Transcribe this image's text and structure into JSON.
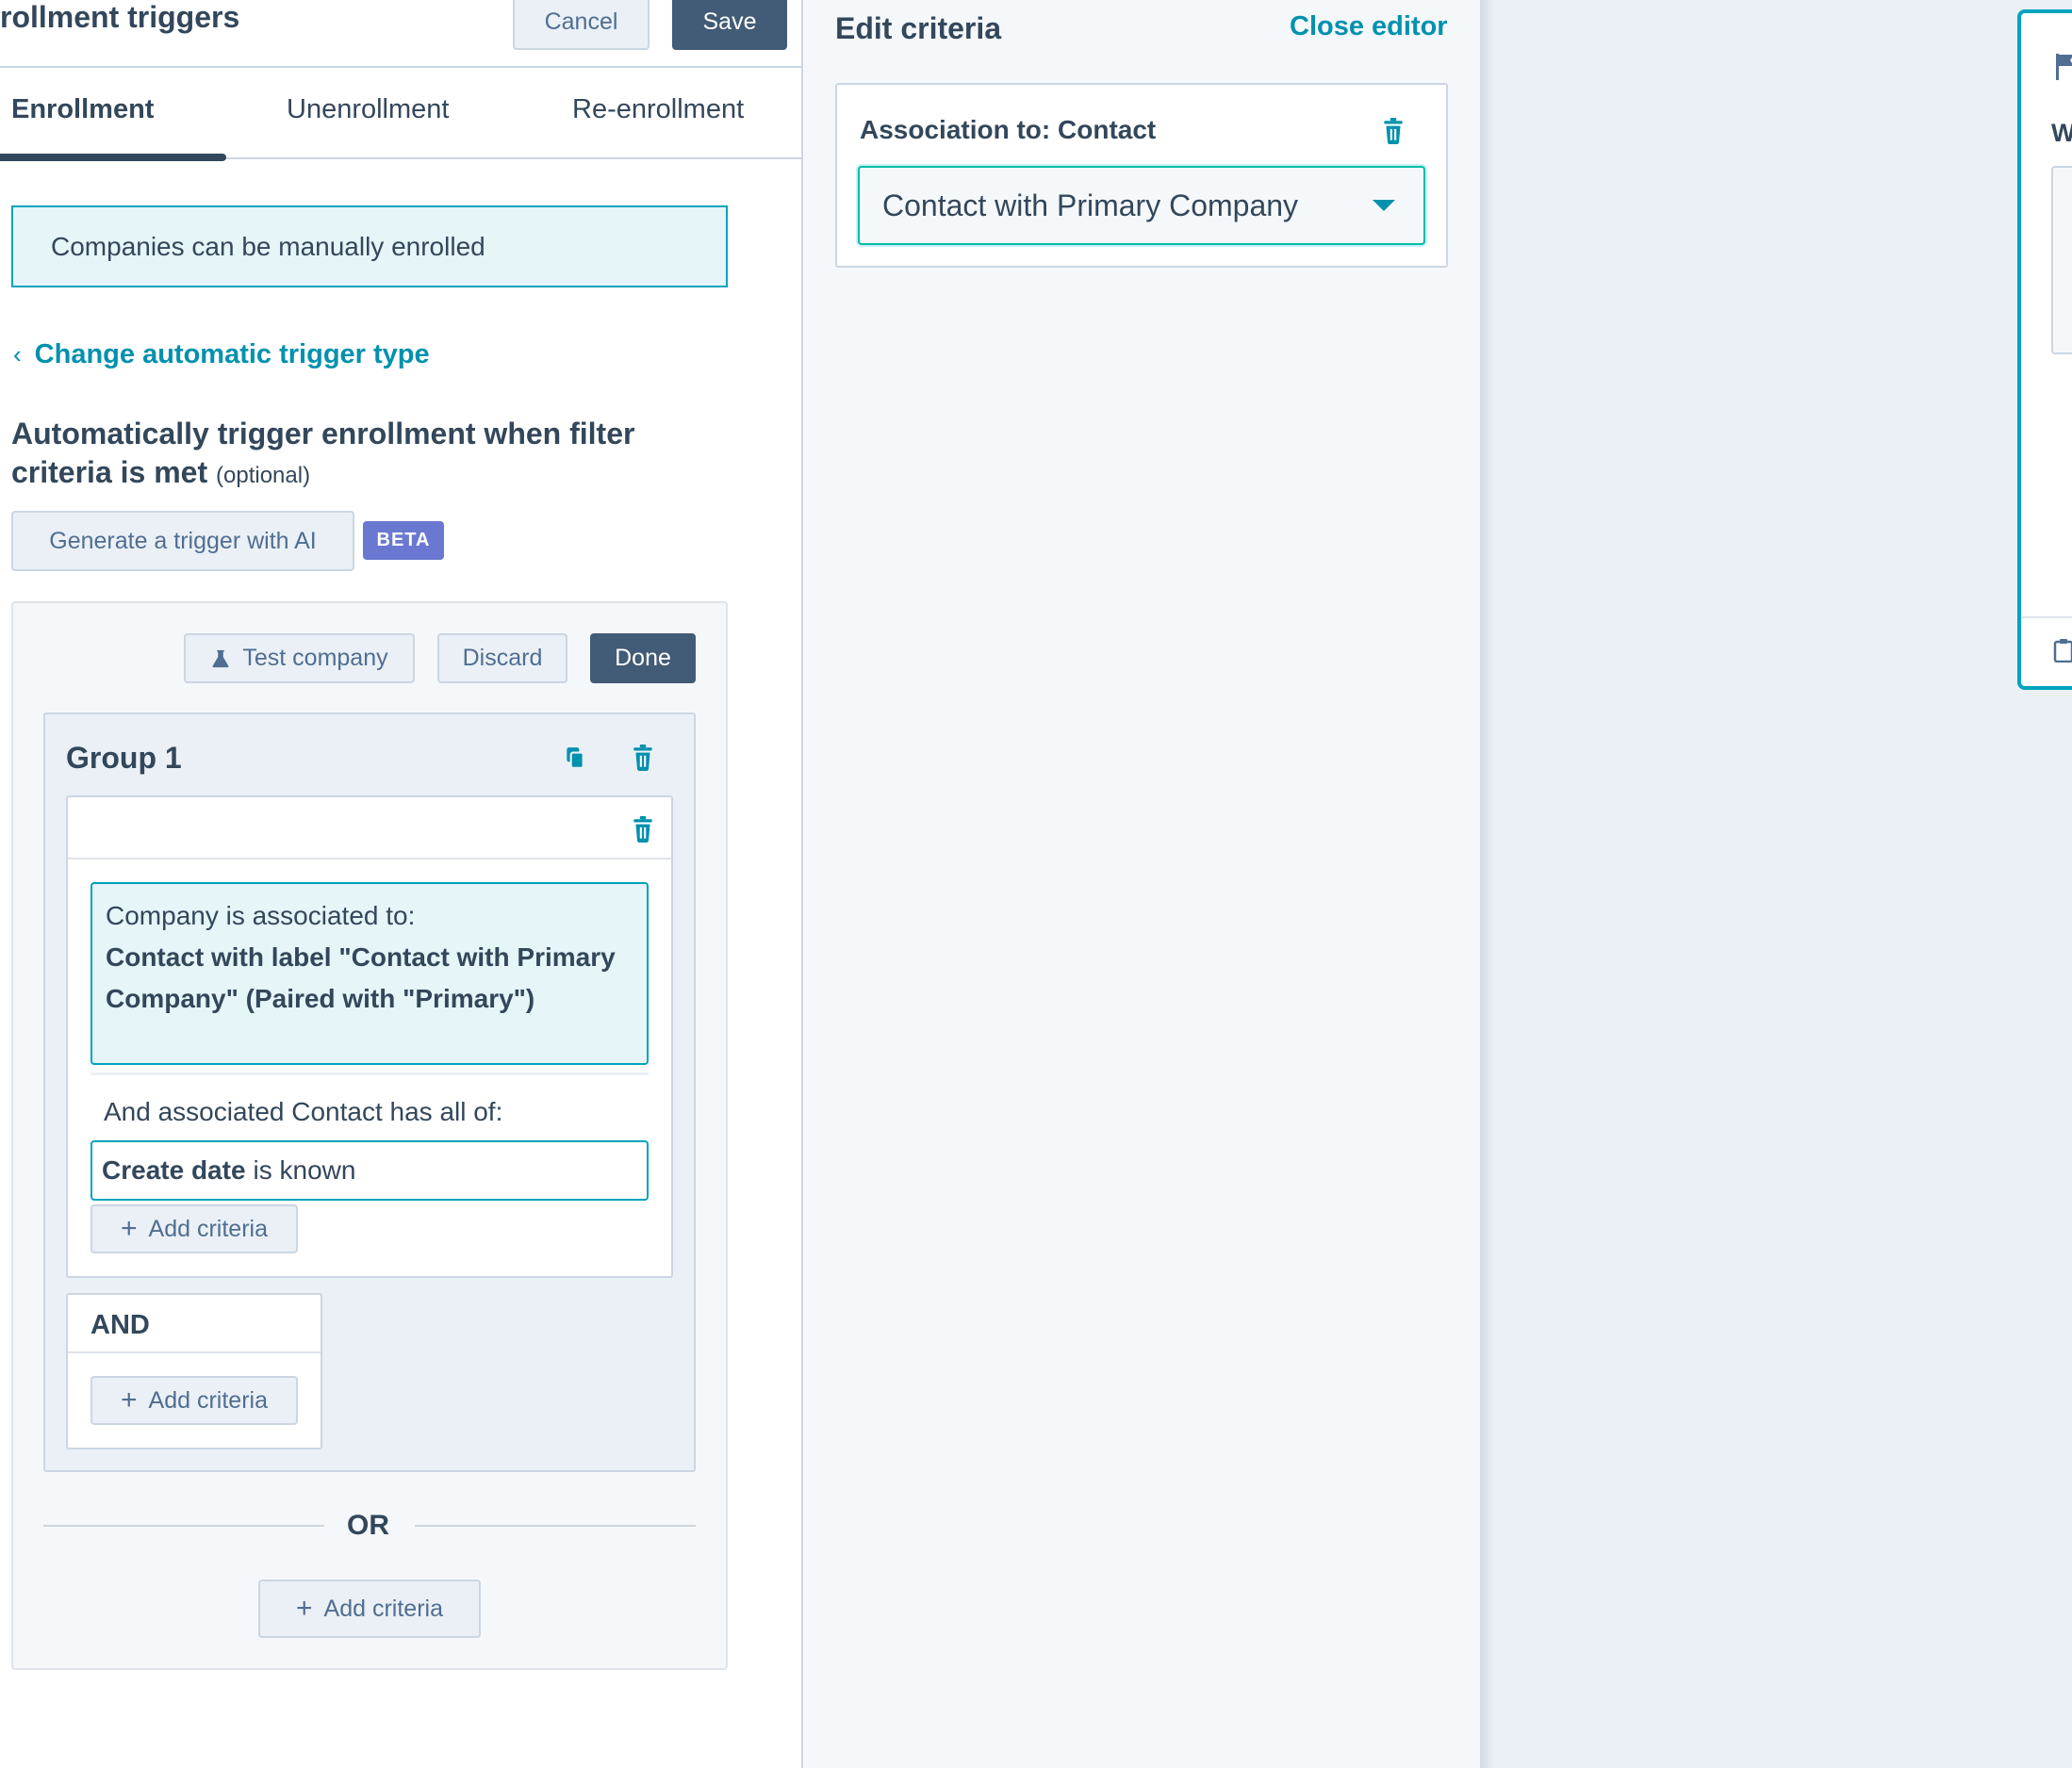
{
  "header": {
    "title": "rollment triggers",
    "cancel_label": "Cancel",
    "save_label": "Save"
  },
  "tabs": [
    {
      "label": "Enrollment",
      "active": true
    },
    {
      "label": "Unenrollment",
      "active": false
    },
    {
      "label": "Re-enrollment",
      "active": false
    }
  ],
  "banner": {
    "text": "Companies can be manually enrolled"
  },
  "change_trigger_link": "Change automatic trigger type",
  "section": {
    "heading": "Automatically trigger enrollment when filter criteria is met",
    "optional": "(optional)",
    "ai_button": "Generate a trigger with AI",
    "beta_badge": "BETA"
  },
  "filter_toolbar": {
    "test_label": "Test company",
    "discard_label": "Discard",
    "done_label": "Done"
  },
  "group": {
    "title": "Group 1",
    "association": {
      "intro": "Company is associated to:",
      "detail": "Contact with label \"Contact with Primary Company\" (Paired with \"Primary\")"
    },
    "assoc_contact_text": "And associated Contact has all of:",
    "criterion": {
      "property": "Create date",
      "operator": "is known"
    },
    "add_criteria_label": "Add criteria",
    "and_label": "AND"
  },
  "or_label": "OR",
  "add_criteria_label": "Add criteria",
  "editor": {
    "title": "Edit criteria",
    "close_label": "Close editor",
    "association_title": "Association to: Contact",
    "association_value": "Contact with Primary Company"
  },
  "right_panel": {
    "label": "W"
  },
  "colors": {
    "primary_text": "#33475b",
    "link": "#0091ae",
    "accent_border": "#00a4bd",
    "dark_button": "#425b76",
    "beta_badge": "#6a78d1",
    "highlight_bg": "#e5f5f8"
  }
}
